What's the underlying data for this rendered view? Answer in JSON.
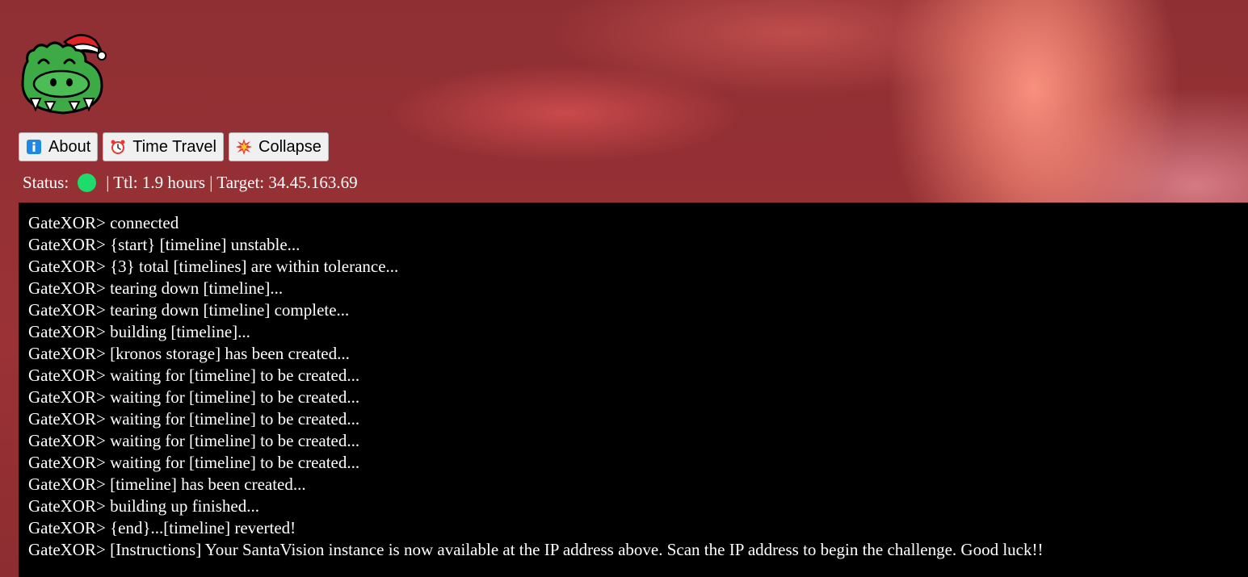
{
  "header": {
    "logo": {
      "icon": "crocodile-santa-hat-logo",
      "colors": {
        "body": "#3cab45",
        "hat": "#e2232a"
      }
    },
    "buttons": [
      {
        "label": "About",
        "icon": "info-icon"
      },
      {
        "label": "Time Travel",
        "icon": "alarm-clock-icon"
      },
      {
        "label": "Collapse",
        "icon": "collision-icon"
      }
    ],
    "status": {
      "label": "Status:",
      "indicator_color": "#1ddc6b",
      "details": "| Ttl: 1.9 hours | Target: 34.45.163.69"
    }
  },
  "terminal": {
    "prompt": "GateXOR>",
    "lines": [
      "GateXOR> connected",
      "GateXOR> {start} [timeline] unstable...",
      "GateXOR> {3} total [timelines] are within tolerance...",
      "GateXOR> tearing down [timeline]...",
      "GateXOR> tearing down [timeline] complete...",
      "GateXOR> building [timeline]...",
      "GateXOR> [kronos storage] has been created...",
      "GateXOR> waiting for [timeline] to be created...",
      "GateXOR> waiting for [timeline] to be created...",
      "GateXOR> waiting for [timeline] to be created...",
      "GateXOR> waiting for [timeline] to be created...",
      "GateXOR> waiting for [timeline] to be created...",
      "GateXOR> [timeline] has been created...",
      "GateXOR> building up finished...",
      "GateXOR> {end}...[timeline] reverted!",
      "GateXOR> [Instructions] Your SantaVision instance is now available at the IP address above. Scan the IP address to begin the challenge. Good luck!!"
    ]
  }
}
